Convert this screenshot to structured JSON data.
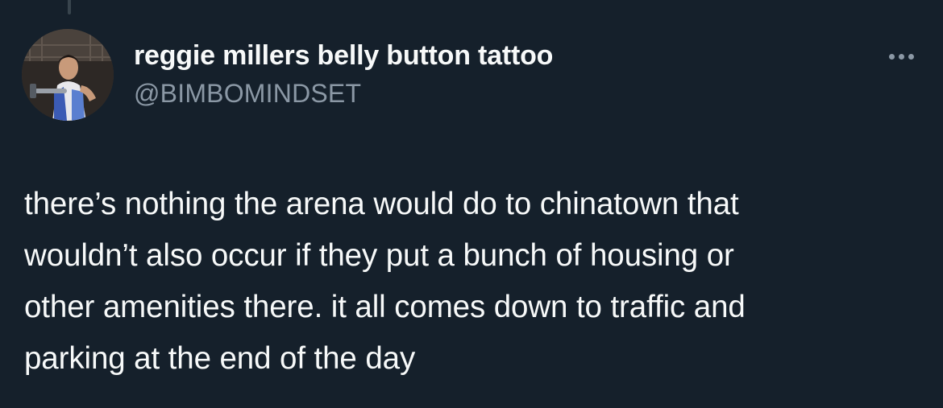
{
  "tweet": {
    "author": {
      "display_name": "reggie millers belly button tattoo",
      "handle": "@BIMBOMINDSET"
    },
    "text": "there’s nothing the arena would do to chinatown that\nwouldn’t also occur if they put a bunch of housing or\nother amenities there. it all comes down to traffic and\nparking at the end of the day",
    "more_icon": "more-horizontal-icon"
  },
  "colors": {
    "background": "#15202b",
    "primary_text": "#f7f9f9",
    "secondary_text": "#8b98a5",
    "thread_line": "#38444d"
  }
}
